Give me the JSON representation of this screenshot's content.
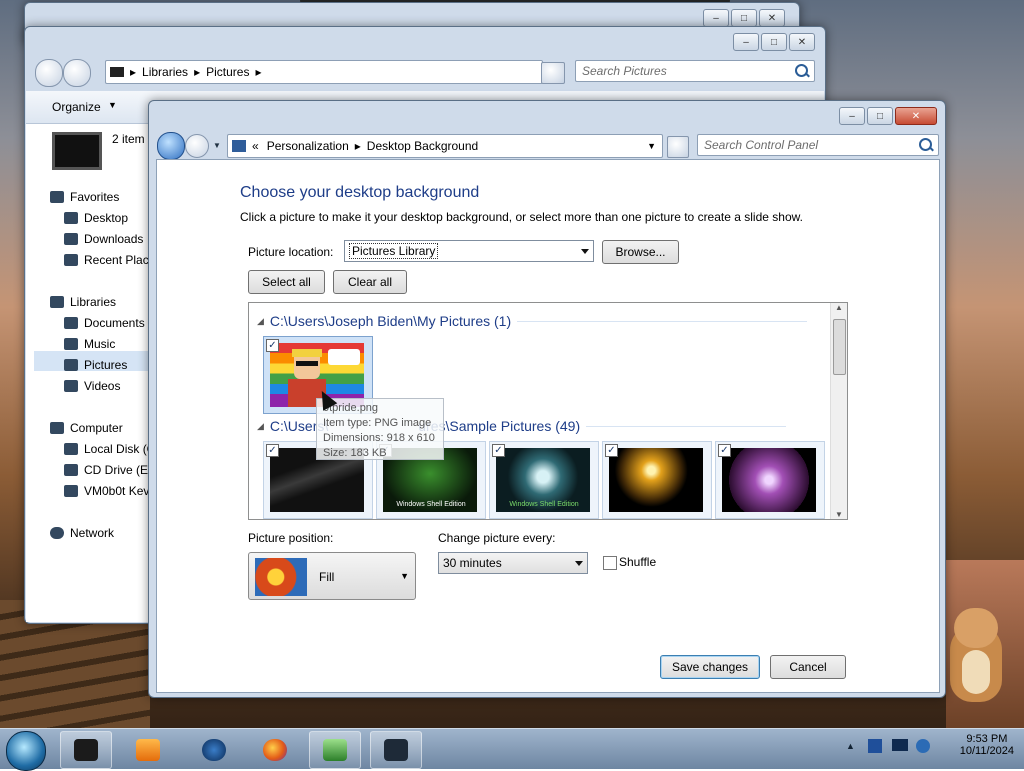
{
  "explorer": {
    "address": [
      "Libraries",
      "Pictures"
    ],
    "search_placeholder": "Search Pictures",
    "organize_label": "Organize",
    "items_count": "2 item",
    "nav": {
      "favorites": "Favorites",
      "desktop": "Desktop",
      "downloads": "Downloads",
      "recent": "Recent Place",
      "libraries": "Libraries",
      "documents": "Documents",
      "music": "Music",
      "pictures": "Pictures",
      "videos": "Videos",
      "computer": "Computer",
      "local_disk": "Local Disk (C",
      "cd_drive": "CD Drive (E:",
      "vm": "VM0b0t Kev",
      "network": "Network"
    }
  },
  "control_panel": {
    "address_prefix": "«",
    "address": [
      "Personalization",
      "Desktop Background"
    ],
    "search_placeholder": "Search Control Panel",
    "heading": "Choose your desktop background",
    "subheading": "Click a picture to make it your desktop background, or select more than one picture to create a slide show.",
    "picture_location_label": "Picture location:",
    "picture_location_value": "Pictures Library",
    "browse_label": "Browse...",
    "select_all_label": "Select all",
    "clear_all_label": "Clear all",
    "groups": [
      {
        "path": "C:\\Users\\Joseph Biden\\My Pictures (1)"
      },
      {
        "path": "C:\\Users\\Public\\Public Pictures\\Sample Pictures (49)"
      }
    ],
    "group2_visible": "C:\\Users\\",
    "group2_tail": "ures\\Sample Pictures (49)",
    "thumb_caption": "Windows Shell Edition",
    "tooltip": {
      "name": "0tpride.png",
      "type": "Item type: PNG image",
      "dimensions": "Dimensions: 918 x 610",
      "size": "Size: 183 KB"
    },
    "picture_position_label": "Picture position:",
    "picture_position_value": "Fill",
    "change_every_label": "Change picture every:",
    "change_every_value": "30 minutes",
    "shuffle_label": "Shuffle",
    "save_label": "Save changes",
    "cancel_label": "Cancel"
  },
  "taskbar": {
    "time": "9:53 PM",
    "date": "10/11/2024"
  }
}
